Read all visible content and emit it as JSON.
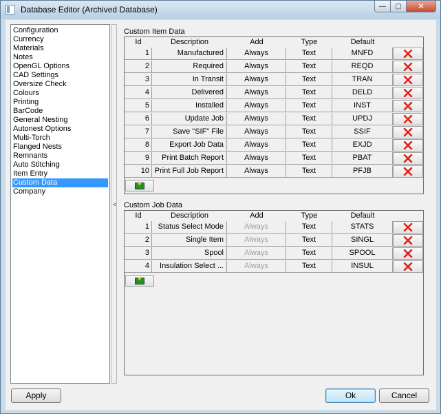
{
  "window": {
    "title": "Database Editor (Archived Database)",
    "minimize": "—",
    "maximize": "▢",
    "close": "✕"
  },
  "nav": {
    "items": [
      "Configuration",
      "Currency",
      "Materials",
      "Notes",
      "OpenGL Options",
      "CAD Settings",
      "Oversize Check",
      "Colours",
      "Printing",
      "BarCode",
      "General Nesting",
      "Autonest Options",
      "Multi-Torch",
      "Flanged Nests",
      "Remnants",
      "Auto Stitching",
      "Item Entry",
      "Custom Data",
      "Company"
    ],
    "selected": "Custom Data",
    "collapse_arrow": "<"
  },
  "columns": {
    "id": "Id",
    "description": "Description",
    "add": "Add",
    "type": "Type",
    "default": "Default"
  },
  "item_data": {
    "label": "Custom Item Data",
    "rows": [
      {
        "id": "1",
        "description": "Manufactured",
        "add": "Always",
        "type": "Text",
        "default": "MNFD"
      },
      {
        "id": "2",
        "description": "Required",
        "add": "Always",
        "type": "Text",
        "default": "REQD"
      },
      {
        "id": "3",
        "description": "In Transit",
        "add": "Always",
        "type": "Text",
        "default": "TRAN"
      },
      {
        "id": "4",
        "description": "Delivered",
        "add": "Always",
        "type": "Text",
        "default": "DELD"
      },
      {
        "id": "5",
        "description": "Installed",
        "add": "Always",
        "type": "Text",
        "default": "INST"
      },
      {
        "id": "6",
        "description": "Update Job",
        "add": "Always",
        "type": "Text",
        "default": "UPDJ"
      },
      {
        "id": "7",
        "description": "Save \"SIF\" File",
        "add": "Always",
        "type": "Text",
        "default": "SSIF"
      },
      {
        "id": "8",
        "description": "Export Job Data",
        "add": "Always",
        "type": "Text",
        "default": "EXJD"
      },
      {
        "id": "9",
        "description": "Print Batch Report",
        "add": "Always",
        "type": "Text",
        "default": "PBAT"
      },
      {
        "id": "10",
        "description": "Print Full Job Report",
        "add": "Always",
        "type": "Text",
        "default": "PFJB"
      }
    ]
  },
  "job_data": {
    "label": "Custom Job Data",
    "rows": [
      {
        "id": "1",
        "description": "Status Select Mode",
        "add": "Always",
        "type": "Text",
        "default": "STATS"
      },
      {
        "id": "2",
        "description": "Single Item",
        "add": "Always",
        "type": "Text",
        "default": "SINGL"
      },
      {
        "id": "3",
        "description": "Spool",
        "add": "Always",
        "type": "Text",
        "default": "SPOOL"
      },
      {
        "id": "4",
        "description": "Insulation Select ...",
        "add": "Always",
        "type": "Text",
        "default": "INSUL"
      }
    ]
  },
  "buttons": {
    "apply": "Apply",
    "ok": "Ok",
    "cancel": "Cancel"
  },
  "colors": {
    "selection": "#3399ff",
    "delete_icon": "#e0201a",
    "add_icon": "#2c8b2c"
  }
}
